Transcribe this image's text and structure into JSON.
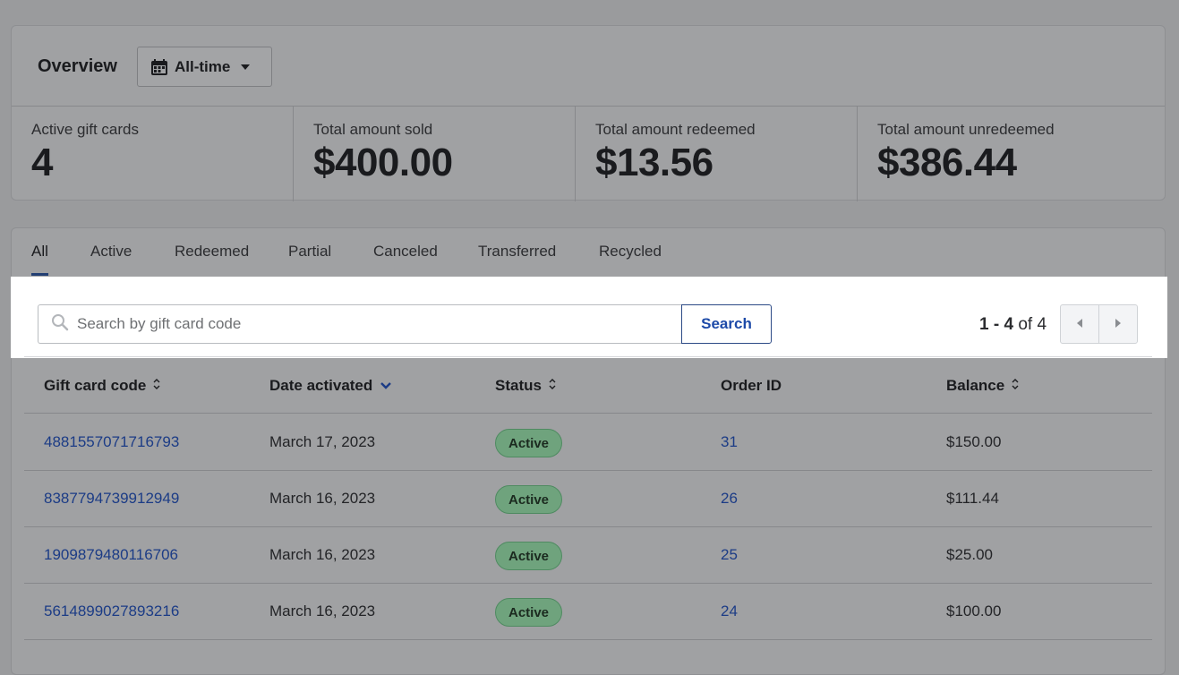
{
  "overview": {
    "title": "Overview",
    "range_label": "All-time",
    "stats": [
      {
        "label": "Active gift cards",
        "value": "4"
      },
      {
        "label": "Total amount sold",
        "value": "$400.00"
      },
      {
        "label": "Total amount redeemed",
        "value": "$13.56"
      },
      {
        "label": "Total amount unredeemed",
        "value": "$386.44"
      }
    ]
  },
  "tabs": [
    "All",
    "Active",
    "Redeemed",
    "Partial",
    "Canceled",
    "Transferred",
    "Recycled"
  ],
  "active_tab": "All",
  "search": {
    "placeholder": "Search by gift card code",
    "button_label": "Search"
  },
  "pager": {
    "range": "1 - 4",
    "of_label": "of",
    "total": "4"
  },
  "table": {
    "headers": [
      "Gift card code",
      "Date activated",
      "Status",
      "Order ID",
      "Balance"
    ],
    "rows": [
      {
        "code": "4881557071716793",
        "date": "March 17, 2023",
        "status": "Active",
        "order": "31",
        "balance": "$150.00"
      },
      {
        "code": "8387794739912949",
        "date": "March 16, 2023",
        "status": "Active",
        "order": "26",
        "balance": "$111.44"
      },
      {
        "code": "1909879480116706",
        "date": "March 16, 2023",
        "status": "Active",
        "order": "25",
        "balance": "$25.00"
      },
      {
        "code": "5614899027893216",
        "date": "March 16, 2023",
        "status": "Active",
        "order": "24",
        "balance": "$100.00"
      }
    ]
  },
  "icons": {
    "calendar": "calendar-icon",
    "caret": "caret-down-icon",
    "search": "search-icon",
    "sort": "sort-icon",
    "sort_desc": "chevron-down-icon",
    "prev": "chevron-left-icon",
    "next": "chevron-right-icon"
  },
  "colors": {
    "link": "#1c3c86",
    "accent": "#233f73",
    "badge": "#6fa37d",
    "overlay": "#9a9b9d"
  }
}
